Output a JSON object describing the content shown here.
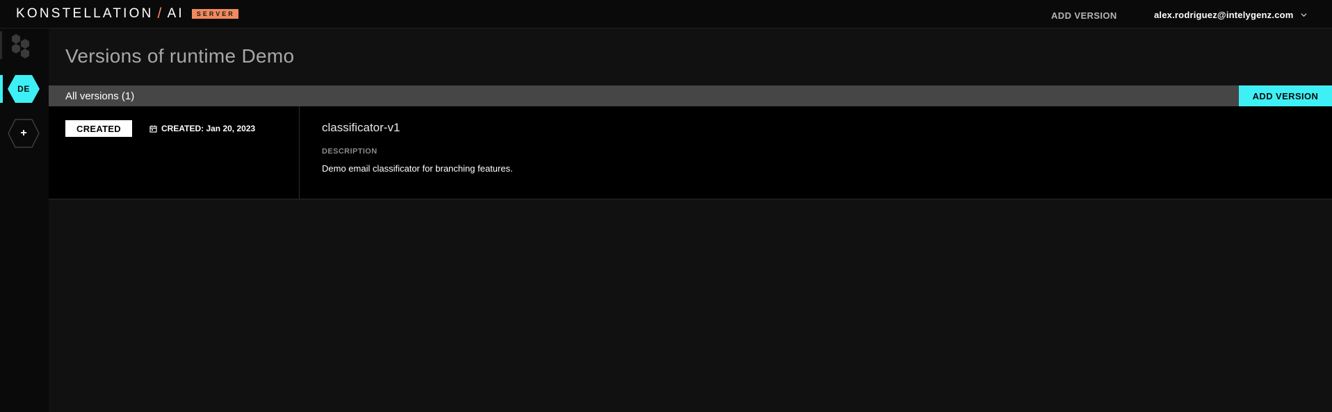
{
  "header": {
    "logo_text_left": "KONSTELLATION",
    "logo_slash": "/",
    "logo_text_right": "AI",
    "logo_badge": "SERVER",
    "add_version_label": "ADD VERSION",
    "user_email": "alex.rodriguez@intelygenz.com",
    "user_menu_icon": "chevron-down-icon"
  },
  "sidebar": {
    "home_icon": "hexagons-icon",
    "runtime_item_label": "DE",
    "add_runtime_label": "+"
  },
  "main": {
    "page_title": "Versions of runtime Demo",
    "section_title": "All versions (1)",
    "section_add_label": "ADD VERSION",
    "versions": [
      {
        "status": "CREATED",
        "created": "CREATED: Jan 20, 2023",
        "name": "classificator-v1",
        "description_label": "DESCRIPTION",
        "description": "Demo email classificator for branching features."
      }
    ]
  },
  "colors": {
    "accent": "#3ef0f5",
    "badge": "#f08a5d",
    "background": "#111111",
    "section_bar": "#464646"
  }
}
